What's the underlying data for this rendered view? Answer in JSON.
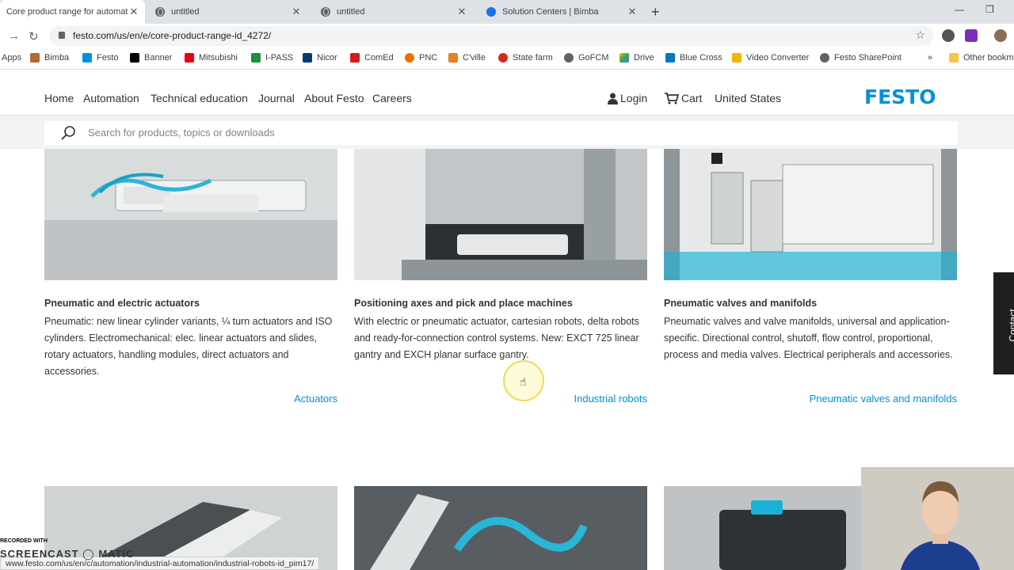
{
  "browser": {
    "tabs": [
      {
        "title": "Core product range for automati",
        "active": true
      },
      {
        "title": "untitled",
        "active": false
      },
      {
        "title": "untitled",
        "active": false
      },
      {
        "title": "Solution Centers | Bimba",
        "active": false
      }
    ],
    "close_glyph": "✕",
    "new_tab_glyph": "+",
    "url": "festo.com/us/en/e/core-product-range-id_4272/",
    "bookmarks": [
      "Apps",
      "Bimba",
      "Festo",
      "Banner",
      "Mitsubishi",
      "I-PASS",
      "Nicor",
      "ComEd",
      "PNC",
      "C'ville",
      "State farm",
      "GoFCM",
      "Drive",
      "Blue Cross",
      "Video Converter",
      "Festo SharePoint"
    ],
    "bookmarks_overflow": "»",
    "other_bookmarks": "Other bookm"
  },
  "site": {
    "nav": [
      "Home",
      "Automation",
      "Technical education",
      "Journal",
      "About Festo",
      "Careers"
    ],
    "login": "Login",
    "cart": "Cart",
    "region": "United States",
    "logo": "FESTO",
    "search_placeholder": "Search for products, topics or downloads"
  },
  "cards": [
    {
      "title": "Pneumatic and electric actuators",
      "description": "Pneumatic: new linear cylinder variants, ¼ turn actuators and ISO cylinders. Electromechanical: elec. linear actuators and slides, rotary actuators, handling modules, direct actuators and accessories.",
      "link": "Actuators"
    },
    {
      "title": "Positioning axes and pick and place machines",
      "description": "With electric or pneumatic actuator, cartesian robots, delta robots and ready-for-connection control systems. New: EXCT 725 linear gantry and EXCH planar surface gantry.",
      "link": "Industrial robots"
    },
    {
      "title": "Pneumatic valves and manifolds",
      "description": "Pneumatic valves and valve manifolds, universal and application-specific. Directional control, shutoff, flow control, proportional, process and media valves. Electrical peripherals and accessories.",
      "link": "Pneumatic valves and manifolds"
    }
  ],
  "contact_tab": "Contact",
  "status_url": "www.festo.com/us/en/c/automation/industrial-automation/industrial-robots-id_pim17/",
  "watermark": {
    "recorded": "RECORDED WITH",
    "brand": "SCREENCAST ◯ MATIC"
  },
  "colors": {
    "accent": "#0091dc",
    "text": "#333333",
    "search_strip": "#f2f3f5"
  }
}
